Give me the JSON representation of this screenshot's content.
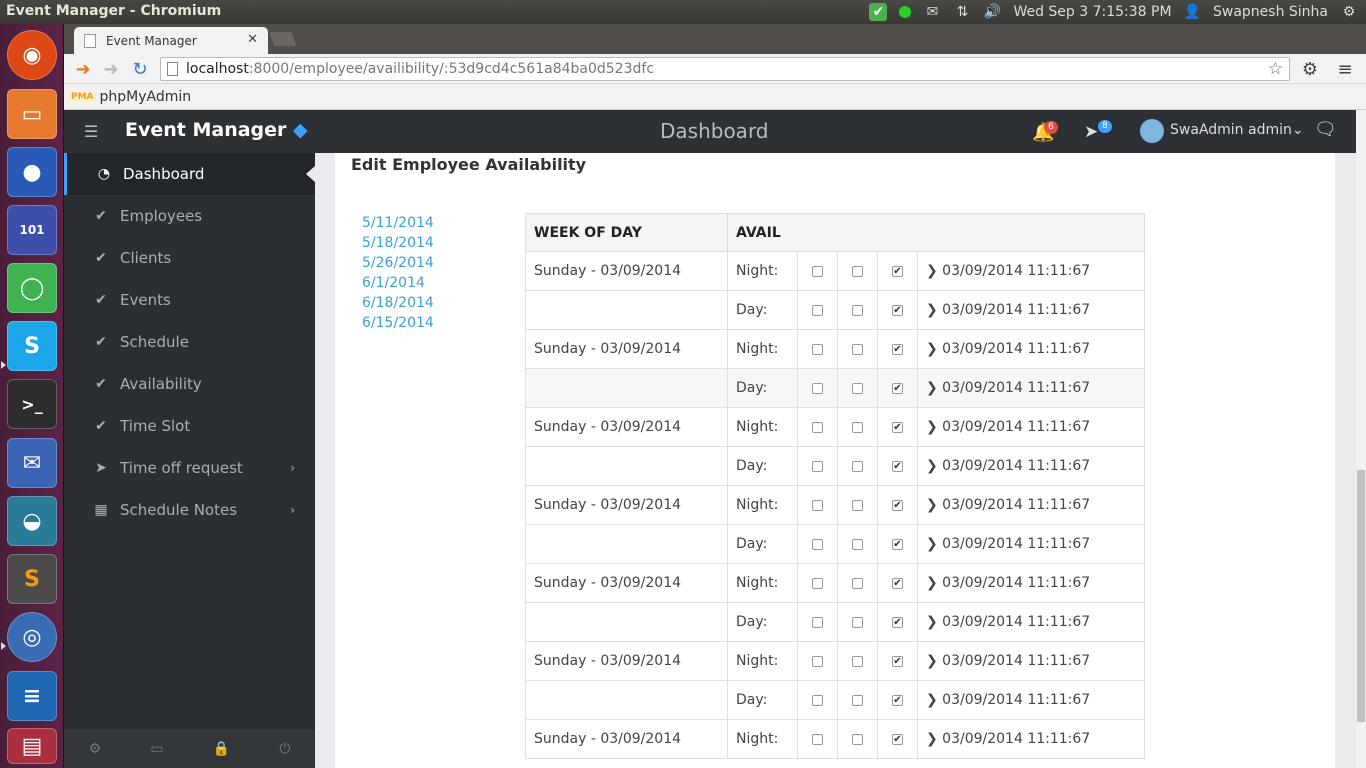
{
  "os": {
    "window_title": "Event Manager - Chromium",
    "clock": "Wed Sep  3  7:15:38 PM",
    "user": "Swapnesh Sinha"
  },
  "browser": {
    "tab_title": "Event Manager",
    "url_host": "localhost",
    "url_rest": ":8000/employee/availibility/:53d9cd4c561a84ba0d523dfc",
    "bookmark": "phpMyAdmin",
    "bookmark_icon": "PMA"
  },
  "app": {
    "brand": "Event Manager",
    "brand_mark": "◆",
    "page_title": "Dashboard",
    "notif_count": "6",
    "msg_count": "8",
    "user_label": "SwaAdmin admin"
  },
  "sidebar": {
    "items": [
      {
        "label": "Dashboard",
        "icon": "dashboard-icon"
      },
      {
        "label": "Employees",
        "icon": "check-circle-icon"
      },
      {
        "label": "Clients",
        "icon": "check-circle-icon"
      },
      {
        "label": "Events",
        "icon": "check-circle-icon"
      },
      {
        "label": "Schedule",
        "icon": "check-circle-icon"
      },
      {
        "label": "Availability",
        "icon": "check-circle-icon"
      },
      {
        "label": "Time Slot",
        "icon": "check-circle-icon"
      },
      {
        "label": "Time off request",
        "icon": "paper-plane-icon"
      },
      {
        "label": "Schedule Notes",
        "icon": "table-icon"
      }
    ]
  },
  "panel": {
    "heading": "Edit Employee Availability",
    "dates": [
      "5/11/2014",
      "5/18/2014",
      "5/26/2014",
      "6/1/2014",
      "6/18/2014",
      "6/15/2014"
    ]
  },
  "table": {
    "headers": [
      "WEEK OF DAY",
      "AVAIL"
    ],
    "rows": [
      {
        "day": "Sunday - 03/09/2014",
        "slot": "Night:",
        "checks": [
          false,
          false,
          true
        ],
        "ts": "❯ 03/09/2014 11:11:67"
      },
      {
        "day": "",
        "slot": "Day:",
        "checks": [
          false,
          false,
          true
        ],
        "ts": "❯ 03/09/2014 11:11:67"
      },
      {
        "day": "Sunday - 03/09/2014",
        "slot": "Night:",
        "checks": [
          false,
          false,
          true
        ],
        "ts": "❯ 03/09/2014 11:11:67"
      },
      {
        "day": "",
        "slot": "Day:",
        "checks": [
          false,
          false,
          true
        ],
        "ts": "❯ 03/09/2014 11:11:67"
      },
      {
        "day": "Sunday - 03/09/2014",
        "slot": "Night:",
        "checks": [
          false,
          false,
          true
        ],
        "ts": "❯ 03/09/2014 11:11:67"
      },
      {
        "day": "",
        "slot": "Day:",
        "checks": [
          false,
          false,
          true
        ],
        "ts": "❯ 03/09/2014 11:11:67"
      },
      {
        "day": "Sunday - 03/09/2014",
        "slot": "Night:",
        "checks": [
          false,
          false,
          true
        ],
        "ts": "❯ 03/09/2014 11:11:67"
      },
      {
        "day": "",
        "slot": "Day:",
        "checks": [
          false,
          false,
          true
        ],
        "ts": "❯ 03/09/2014 11:11:67"
      },
      {
        "day": "Sunday - 03/09/2014",
        "slot": "Night:",
        "checks": [
          false,
          false,
          true
        ],
        "ts": "❯ 03/09/2014 11:11:67"
      },
      {
        "day": "",
        "slot": "Day:",
        "checks": [
          false,
          false,
          true
        ],
        "ts": "❯ 03/09/2014 11:11:67"
      },
      {
        "day": "Sunday - 03/09/2014",
        "slot": "Night:",
        "checks": [
          false,
          false,
          true
        ],
        "ts": "❯ 03/09/2014 11:11:67"
      },
      {
        "day": "",
        "slot": "Day:",
        "checks": [
          false,
          false,
          true
        ],
        "ts": "❯ 03/09/2014 11:11:67"
      },
      {
        "day": "Sunday - 03/09/2014",
        "slot": "Night:",
        "checks": [
          false,
          false,
          true
        ],
        "ts": "❯ 03/09/2014 11:11:67"
      }
    ]
  },
  "colors": {
    "accent": "#3ea0ff",
    "link": "#3aa0d8",
    "sidebar_bg": "#2b2f33",
    "topbar_bg": "#2d3034"
  }
}
